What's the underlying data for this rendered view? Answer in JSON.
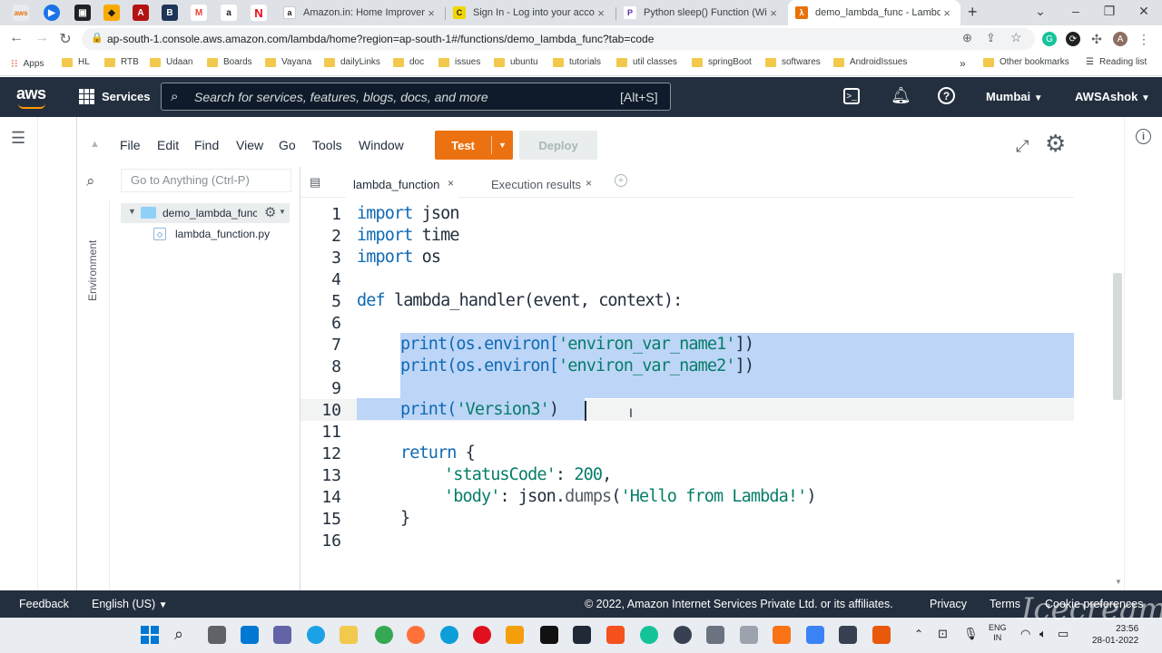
{
  "browser": {
    "tabs": [
      {
        "title": "Amazon.in: Home Improvemen",
        "favicon": "a"
      },
      {
        "title": "Sign In - Log into your accoun",
        "favicon": "C"
      },
      {
        "title": "Python sleep() Function (With",
        "favicon": "P"
      },
      {
        "title": "demo_lambda_func - Lambda",
        "favicon": "λ",
        "active": true
      }
    ],
    "new_tab": "+",
    "url": "ap-south-1.console.aws.amazon.com/lambda/home?region=ap-south-1#/functions/demo_lambda_func?tab=code",
    "bookmarks": [
      "Apps",
      "HL",
      "RTB",
      "Udaan",
      "Boards",
      "Vayana",
      "dailyLinks",
      "doc",
      "issues",
      "ubuntu",
      "tutorials",
      "util classes",
      "springBoot",
      "softwares",
      "AndroidIssues"
    ],
    "bookmarks_more": "»",
    "other_bookmarks": "Other bookmarks",
    "reading_list": "Reading list"
  },
  "aws": {
    "logo": "aws",
    "services": "Services",
    "search_placeholder": "Search for services, features, blogs, docs, and more",
    "search_shortcut": "[Alt+S]",
    "region": "Mumbai",
    "account": "AWSAshok"
  },
  "ide": {
    "menu": [
      "File",
      "Edit",
      "Find",
      "View",
      "Go",
      "Tools",
      "Window"
    ],
    "test_label": "Test",
    "deploy_label": "Deploy",
    "goto_placeholder": "Go to Anything (Ctrl-P)",
    "environment_label": "Environment",
    "folder": "demo_lambda_func",
    "file": "lambda_function.py",
    "tabs": [
      "lambda_function",
      "Execution results"
    ],
    "line_numbers": [
      "1",
      "2",
      "3",
      "4",
      "5",
      "6",
      "7",
      "8",
      "9",
      "10",
      "11",
      "12",
      "13",
      "14",
      "15",
      "16"
    ]
  },
  "code": {
    "l1a": "import",
    "l1b": " json",
    "l2a": "import",
    "l2b": " time",
    "l3a": "import",
    "l3b": " os",
    "l5a": "def",
    "l5b": " lambda_handler(event, context):",
    "l7a": "print(os.environ[",
    "l7b": "'environ_var_name1'",
    "l7c": "])",
    "l8a": "print(os.environ[",
    "l8b": "'environ_var_name2'",
    "l8c": "])",
    "l10a": "print(",
    "l10b": "'Version3'",
    "l10c": ")",
    "l12a": "return",
    "l12b": " {",
    "l13a": "'statusCode'",
    "l13b": ": ",
    "l13c": "200",
    "l13d": ",",
    "l14a": "'body'",
    "l14b": ": json.",
    "l14c": "dumps",
    "l14d": "(",
    "l14e": "'Hello from Lambda!'",
    "l14f": ")",
    "l15": "}"
  },
  "footer": {
    "feedback": "Feedback",
    "language": "English (US)",
    "copyright": "© 2022, Amazon Internet Services Private Ltd. or its affiliates.",
    "privacy": "Privacy",
    "terms": "Terms",
    "cookies": "Cookie preferences"
  },
  "taskbar": {
    "lang1": "ENG",
    "lang2": "IN",
    "time": "23:56",
    "date": "28-01-2022"
  },
  "watermark": "Icecream"
}
